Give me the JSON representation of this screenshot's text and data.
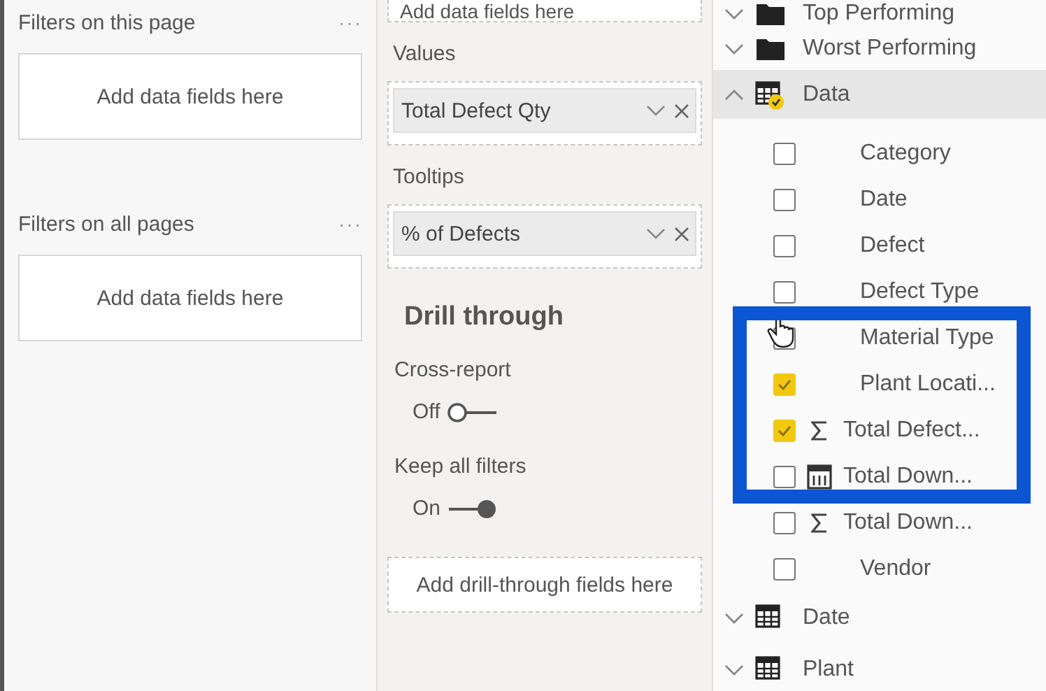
{
  "filters": {
    "sections": [
      {
        "title": "Filters on this page",
        "more": "···",
        "placeholder": "Add data fields here"
      },
      {
        "title": "Filters on all pages",
        "more": "···",
        "placeholder": "Add data fields here"
      }
    ]
  },
  "visualizations": {
    "top_well": {
      "placeholder": "Add data fields here"
    },
    "wells": [
      {
        "label": "Values",
        "field": "Total Defect Qty"
      },
      {
        "label": "Tooltips",
        "field": "% of Defects"
      }
    ],
    "drill_through": {
      "title": "Drill through",
      "toggles": [
        {
          "label": "Cross-report",
          "state_text": "Off",
          "on": false
        },
        {
          "label": "Keep all filters",
          "state_text": "On",
          "on": true
        }
      ],
      "placeholder": "Add drill-through fields here"
    }
  },
  "fields": {
    "items": [
      {
        "kind": "folder",
        "name": "Top Performing",
        "expanded": false
      },
      {
        "kind": "folder",
        "name": "Worst Performing",
        "expanded": false
      },
      {
        "kind": "table",
        "name": "Data",
        "expanded": true,
        "in_use": true,
        "selected": true,
        "children": [
          {
            "kind": "column",
            "name": "Category",
            "checked": false
          },
          {
            "kind": "column",
            "name": "Date",
            "checked": false
          },
          {
            "kind": "column",
            "name": "Defect",
            "checked": false
          },
          {
            "kind": "column",
            "name": "Defect Type",
            "checked": false
          },
          {
            "kind": "column",
            "name": "Material Type",
            "checked": false,
            "hovered": true
          },
          {
            "kind": "column",
            "name": "Plant Locati...",
            "checked": true
          },
          {
            "kind": "measure",
            "name": "Total Defect...",
            "checked": true
          },
          {
            "kind": "calculated",
            "name": "Total Down...",
            "checked": false
          },
          {
            "kind": "measure",
            "name": "Total Down...",
            "checked": false
          },
          {
            "kind": "column",
            "name": "Vendor",
            "checked": false
          }
        ]
      },
      {
        "kind": "table",
        "name": "Date",
        "expanded": false,
        "in_use": false,
        "selected": false
      },
      {
        "kind": "table",
        "name": "Plant",
        "expanded": false,
        "in_use": false,
        "selected": false
      }
    ]
  }
}
